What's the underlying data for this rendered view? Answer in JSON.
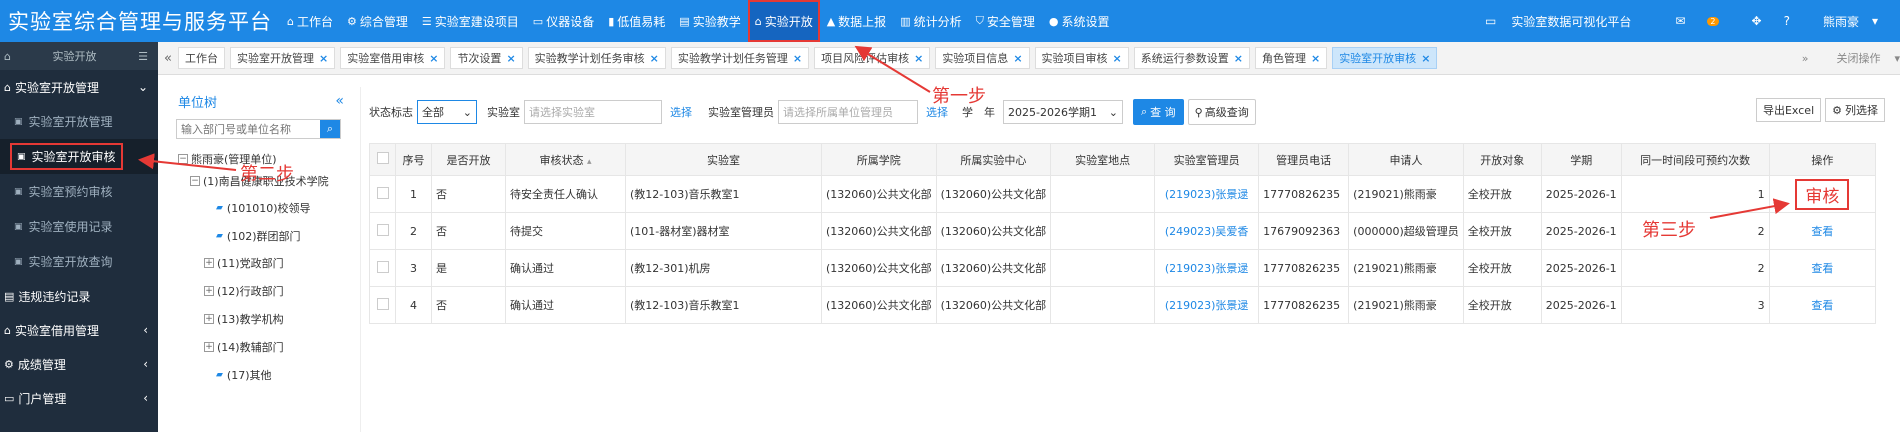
{
  "header": {
    "app_title": "实验室综合管理与服务平台",
    "nav": [
      {
        "icon": "home-icon",
        "glyph": "⌂",
        "label": "工作台"
      },
      {
        "icon": "gear-icon",
        "glyph": "⚙",
        "label": "综合管理"
      },
      {
        "icon": "list-icon",
        "glyph": "☰",
        "label": "实验室建设项目"
      },
      {
        "icon": "monitor-icon",
        "glyph": "▭",
        "label": "仪器设备"
      },
      {
        "icon": "chart-icon",
        "glyph": "▮",
        "label": "低值易耗"
      },
      {
        "icon": "book-icon",
        "glyph": "▤",
        "label": "实验教学"
      },
      {
        "icon": "open-icon",
        "glyph": "⌂",
        "label": "实验开放"
      },
      {
        "icon": "upload-icon",
        "glyph": "▲",
        "label": "数据上报"
      },
      {
        "icon": "stats-icon",
        "glyph": "▥",
        "label": "统计分析"
      },
      {
        "icon": "shield-icon",
        "glyph": "⛉",
        "label": "安全管理"
      },
      {
        "icon": "settings-icon",
        "glyph": "●",
        "label": "系统设置"
      }
    ],
    "right": {
      "dashboard_label": "实验室数据可视化平台",
      "mail_badge": "2",
      "user_name": "熊雨豪"
    }
  },
  "sidebar": {
    "header_label": "实验开放",
    "groups": [
      {
        "label": "实验室开放管理",
        "chevron": "⌄"
      },
      {
        "label": "违规违约记录",
        "chevron": ""
      },
      {
        "label": "实验室借用管理",
        "chevron": "‹"
      },
      {
        "label": "成绩管理",
        "chevron": "‹"
      },
      {
        "label": "门户管理",
        "chevron": "‹"
      }
    ],
    "subitems": [
      "实验室开放管理",
      "实验室开放审核",
      "实验室预约审核",
      "实验室使用记录",
      "实验室开放查询"
    ]
  },
  "tabs": {
    "items": [
      "工作台",
      "实验室开放管理",
      "实验室借用审核",
      "节次设置",
      "实验教学计划任务审核",
      "实验教学计划任务管理",
      "项目风险评估审核",
      "实验项目信息",
      "实验项目审核",
      "系统运行参数设置",
      "角色管理",
      "实验室开放审核"
    ],
    "close_ops": "关闭操作"
  },
  "tree": {
    "title": "单位树",
    "search_placeholder": "输入部门号或单位名称",
    "nodes": [
      "熊雨豪(管理单位)",
      "(1)南昌健康职业技术学院",
      "(101010)校领导",
      "(102)群团部门",
      "(11)党政部门",
      "(12)行政部门",
      "(13)教学机构",
      "(14)教辅部门",
      "(17)其他"
    ]
  },
  "filters": {
    "status_label": "状态标志",
    "status_value": "全部",
    "lab_label": "实验室",
    "lab_placeholder": "请选择实验室",
    "select_link": "选择",
    "manager_label": "实验室管理员",
    "manager_placeholder": "请选择所属单位管理员",
    "select_link2": "选择",
    "term_label": "学　年",
    "term_value": "2025-2026学期1",
    "query_btn": "查 询",
    "advanced_btn": "高级查询",
    "export_btn": "导出Excel",
    "columns_btn": "列选择"
  },
  "table": {
    "headers": [
      "序号",
      "是否开放",
      "审核状态",
      "实验室",
      "所属学院",
      "所属实验中心",
      "实验室地点",
      "实验室管理员",
      "管理员电话",
      "申请人",
      "开放对象",
      "学期",
      "同一时间段可预约次数",
      "操作"
    ],
    "rows": [
      {
        "no": "1",
        "open": "否",
        "status": "待安全责任人确认",
        "lab": "(教12-103)音乐教室1",
        "college": "(132060)公共文化部",
        "center": "(132060)公共文化部",
        "location": "",
        "manager": "(219023)张景逯",
        "phone": "17770826235",
        "applicant": "(219021)熊雨豪",
        "target": "全校开放",
        "term": "2025-2026-1",
        "times": "1",
        "action": "审核"
      },
      {
        "no": "2",
        "open": "否",
        "status": "待提交",
        "lab": "(101-器材室)器材室",
        "college": "(132060)公共文化部",
        "center": "(132060)公共文化部",
        "location": "",
        "manager": "(249023)吴爱香",
        "phone": "17679092363",
        "applicant": "(000000)超级管理员",
        "target": "全校开放",
        "term": "2025-2026-1",
        "times": "2",
        "action": "查看"
      },
      {
        "no": "3",
        "open": "是",
        "status": "确认通过",
        "lab": "(教12-301)机房",
        "college": "(132060)公共文化部",
        "center": "(132060)公共文化部",
        "location": "",
        "manager": "(219023)张景逯",
        "phone": "17770826235",
        "applicant": "(219021)熊雨豪",
        "target": "全校开放",
        "term": "2025-2026-1",
        "times": "2",
        "action": "查看"
      },
      {
        "no": "4",
        "open": "否",
        "status": "确认通过",
        "lab": "(教12-103)音乐教室1",
        "college": "(132060)公共文化部",
        "center": "(132060)公共文化部",
        "location": "",
        "manager": "(219023)张景逯",
        "phone": "17770826235",
        "applicant": "(219021)熊雨豪",
        "target": "全校开放",
        "term": "2025-2026-1",
        "times": "3",
        "action": "查看"
      }
    ]
  },
  "annotations": {
    "step1": "第一步",
    "step2": "第二步",
    "step3": "第三步",
    "color": "#e53935"
  }
}
